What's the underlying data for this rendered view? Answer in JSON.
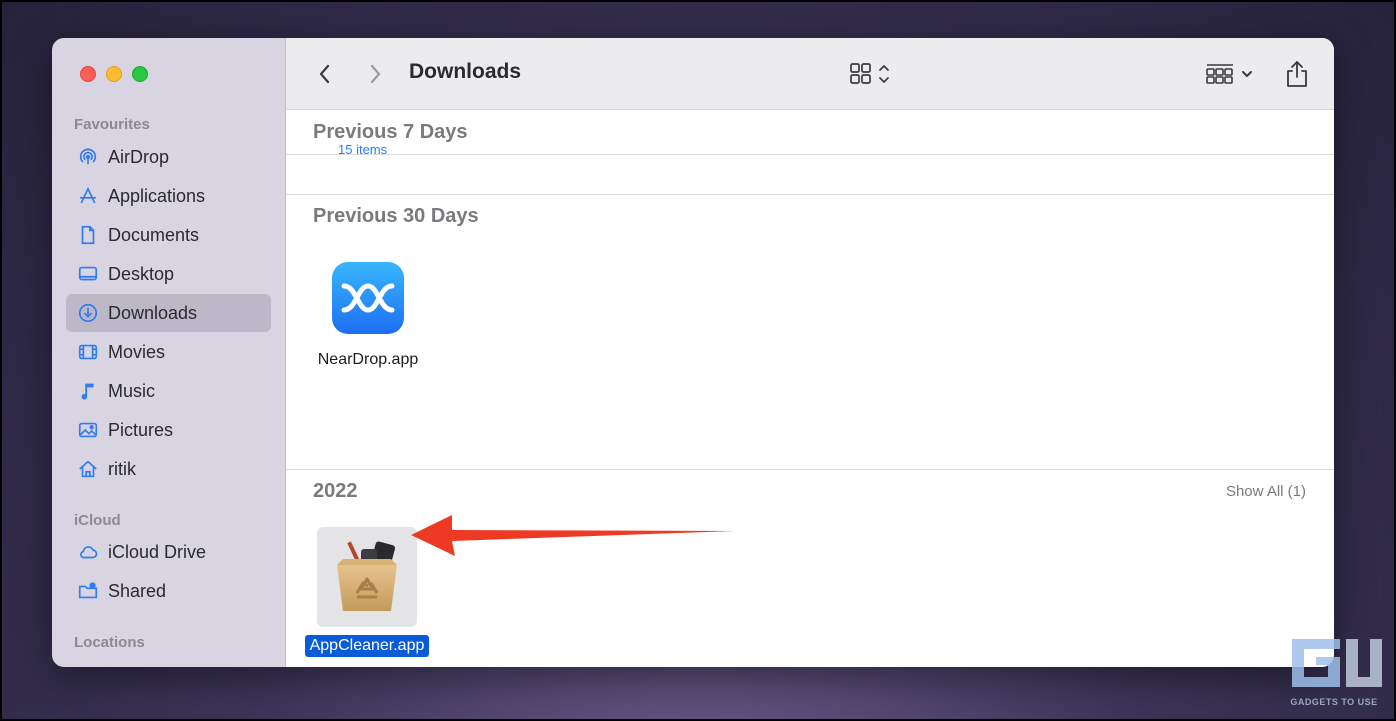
{
  "window": {
    "title": "Downloads"
  },
  "sidebar": {
    "sections": [
      {
        "label": "Favourites",
        "items": [
          {
            "label": "AirDrop",
            "icon": "airdrop-icon"
          },
          {
            "label": "Applications",
            "icon": "applications-icon"
          },
          {
            "label": "Documents",
            "icon": "document-icon"
          },
          {
            "label": "Desktop",
            "icon": "desktop-icon"
          },
          {
            "label": "Downloads",
            "icon": "download-icon",
            "selected": true
          },
          {
            "label": "Movies",
            "icon": "film-icon"
          },
          {
            "label": "Music",
            "icon": "music-note-icon"
          },
          {
            "label": "Pictures",
            "icon": "picture-icon"
          },
          {
            "label": "ritik",
            "icon": "home-icon"
          }
        ]
      },
      {
        "label": "iCloud",
        "items": [
          {
            "label": "iCloud Drive",
            "icon": "cloud-icon"
          },
          {
            "label": "Shared",
            "icon": "shared-folder-icon"
          }
        ]
      },
      {
        "label": "Locations",
        "items": []
      }
    ]
  },
  "toolbar": {
    "back_icon": "chevron-left-icon",
    "forward_icon": "chevron-right-icon",
    "view_icon": "grid-view-icon",
    "group_icon": "group-by-icon",
    "share_icon": "share-icon",
    "tag_icon": "tag-icon",
    "more_icon": "more-icon",
    "search_icon": "search-icon"
  },
  "groups": [
    {
      "title": "Previous 7 Days",
      "collapsed_hint": "15 items"
    },
    {
      "title": "Previous 30 Days",
      "files": [
        {
          "name": "NearDrop.app"
        }
      ]
    },
    {
      "title": "2022",
      "show_all": "Show All (1)",
      "files": [
        {
          "name": "AppCleaner.app",
          "selected": true
        }
      ]
    }
  ],
  "colors": {
    "selection": "#0a5bd6",
    "annotation_arrow": "#ee3a24",
    "sidebar_bg": "#d8d4e2"
  },
  "watermark": {
    "text": "GADGETS TO USE"
  }
}
